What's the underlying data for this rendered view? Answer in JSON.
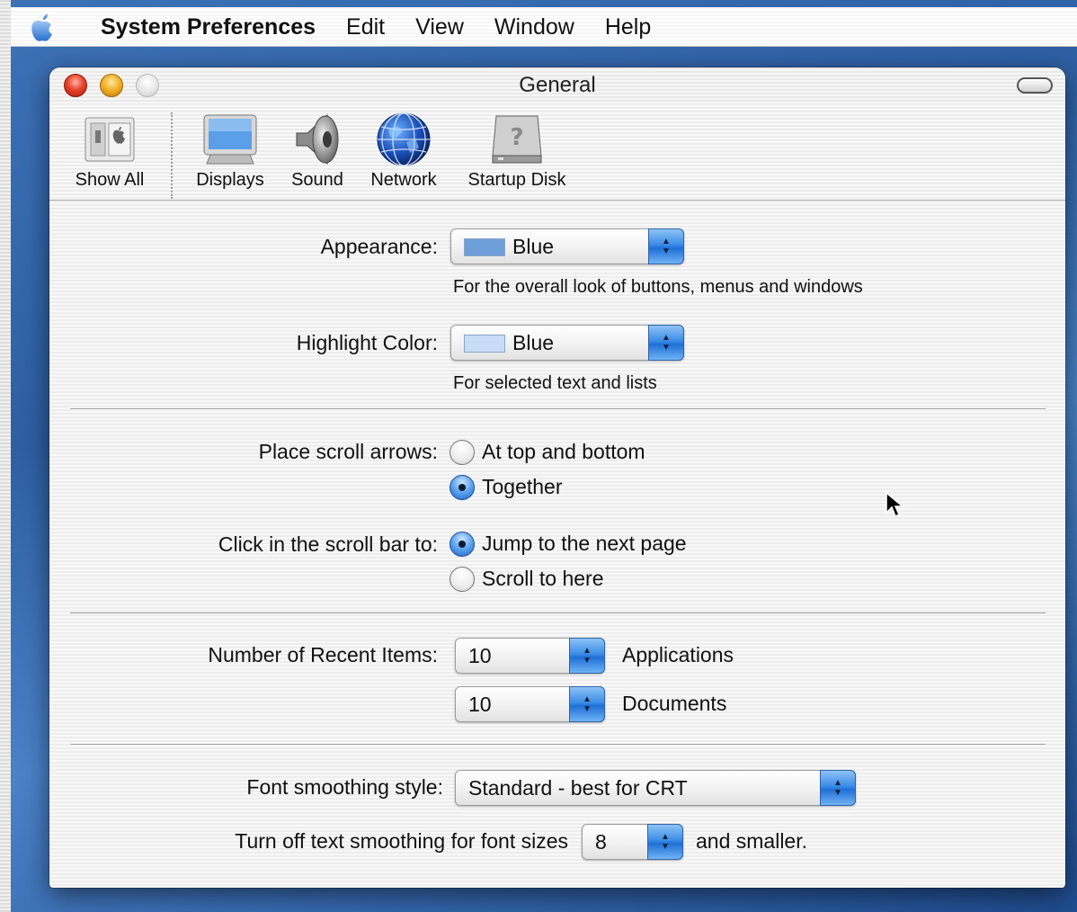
{
  "menubar": {
    "app_name": "System Preferences",
    "items": [
      "Edit",
      "View",
      "Window",
      "Help"
    ]
  },
  "window": {
    "title": "General"
  },
  "toolbar": {
    "items": [
      {
        "label": "Show All",
        "icon": "show-all-icon"
      },
      {
        "label": "Displays",
        "icon": "display-icon"
      },
      {
        "label": "Sound",
        "icon": "speaker-icon"
      },
      {
        "label": "Network",
        "icon": "globe-icon"
      },
      {
        "label": "Startup Disk",
        "icon": "hard-disk-icon"
      }
    ]
  },
  "appearance": {
    "label": "Appearance:",
    "value": "Blue",
    "swatch_color": "#6f9fd8",
    "help": "For the overall look of buttons, menus and windows"
  },
  "highlight": {
    "label": "Highlight Color:",
    "value": "Blue",
    "swatch_color": "#c9dcf7",
    "help": "For selected text and lists"
  },
  "scroll_arrows": {
    "label": "Place scroll arrows:",
    "options": [
      {
        "label": "At top and bottom",
        "selected": false
      },
      {
        "label": "Together",
        "selected": true
      }
    ]
  },
  "scroll_click": {
    "label": "Click in the scroll bar to:",
    "options": [
      {
        "label": "Jump to the next page",
        "selected": true
      },
      {
        "label": "Scroll to here",
        "selected": false
      }
    ]
  },
  "recent_items": {
    "label": "Number of Recent Items:",
    "applications_value": "10",
    "applications_label": "Applications",
    "documents_value": "10",
    "documents_label": "Documents"
  },
  "font_smoothing": {
    "label": "Font smoothing style:",
    "value": "Standard - best for CRT"
  },
  "text_smoothing": {
    "label": "Turn off text smoothing for font sizes",
    "value": "8",
    "suffix": "and smaller."
  },
  "colors": {
    "accent": "#2f7be0",
    "desktop": "#2e5fa3"
  }
}
